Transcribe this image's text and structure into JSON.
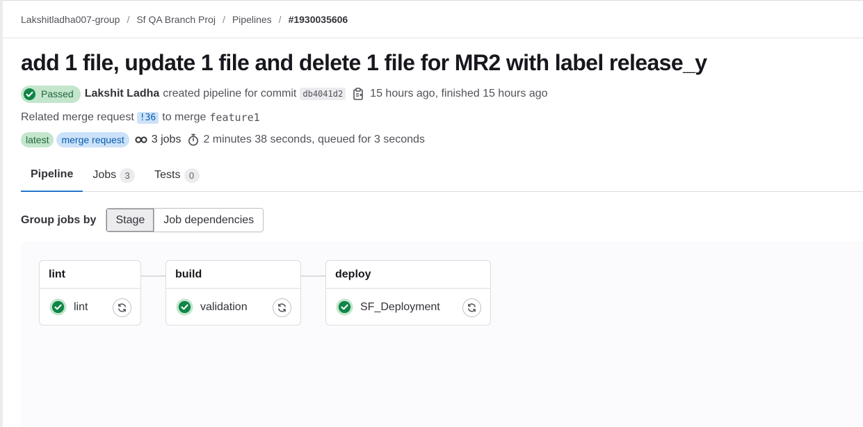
{
  "breadcrumb": [
    "Lakshitladha007-group",
    "Sf QA Branch Proj",
    "Pipelines",
    "#1930035606"
  ],
  "title": "add 1 file, update 1 file and delete 1 file for MR2 with label release_y",
  "status": {
    "label": "Passed",
    "color": "#108548",
    "icon": "check-circle-icon"
  },
  "author": "Lakshit Ladha",
  "created_text": "created pipeline for commit",
  "commit_sha": "db4041d2",
  "copy_icon": "copy-to-clipboard-icon",
  "time_text": "15 hours ago, finished 15 hours ago",
  "related": {
    "prefix": "Related merge request",
    "mr": "!36",
    "middle": "to merge",
    "branch": "feature1"
  },
  "labels": [
    "latest",
    "merge request"
  ],
  "jobs_count": "3 jobs",
  "duration": "2 minutes 38 seconds, queued for 3 seconds",
  "tabs": [
    {
      "label": "Pipeline",
      "count": null,
      "active": true
    },
    {
      "label": "Jobs",
      "count": "3",
      "active": false
    },
    {
      "label": "Tests",
      "count": "0",
      "active": false
    }
  ],
  "group_by": {
    "label": "Group jobs by",
    "options": [
      "Stage",
      "Job dependencies"
    ],
    "selected": "Stage"
  },
  "stages": [
    {
      "name": "lint",
      "jobs": [
        {
          "name": "lint",
          "status": "success"
        }
      ]
    },
    {
      "name": "build",
      "jobs": [
        {
          "name": "validation",
          "status": "success"
        }
      ]
    },
    {
      "name": "deploy",
      "jobs": [
        {
          "name": "SF_Deployment",
          "status": "success"
        }
      ]
    }
  ],
  "colors": {
    "success": "#108548",
    "link": "#1f75cb"
  }
}
